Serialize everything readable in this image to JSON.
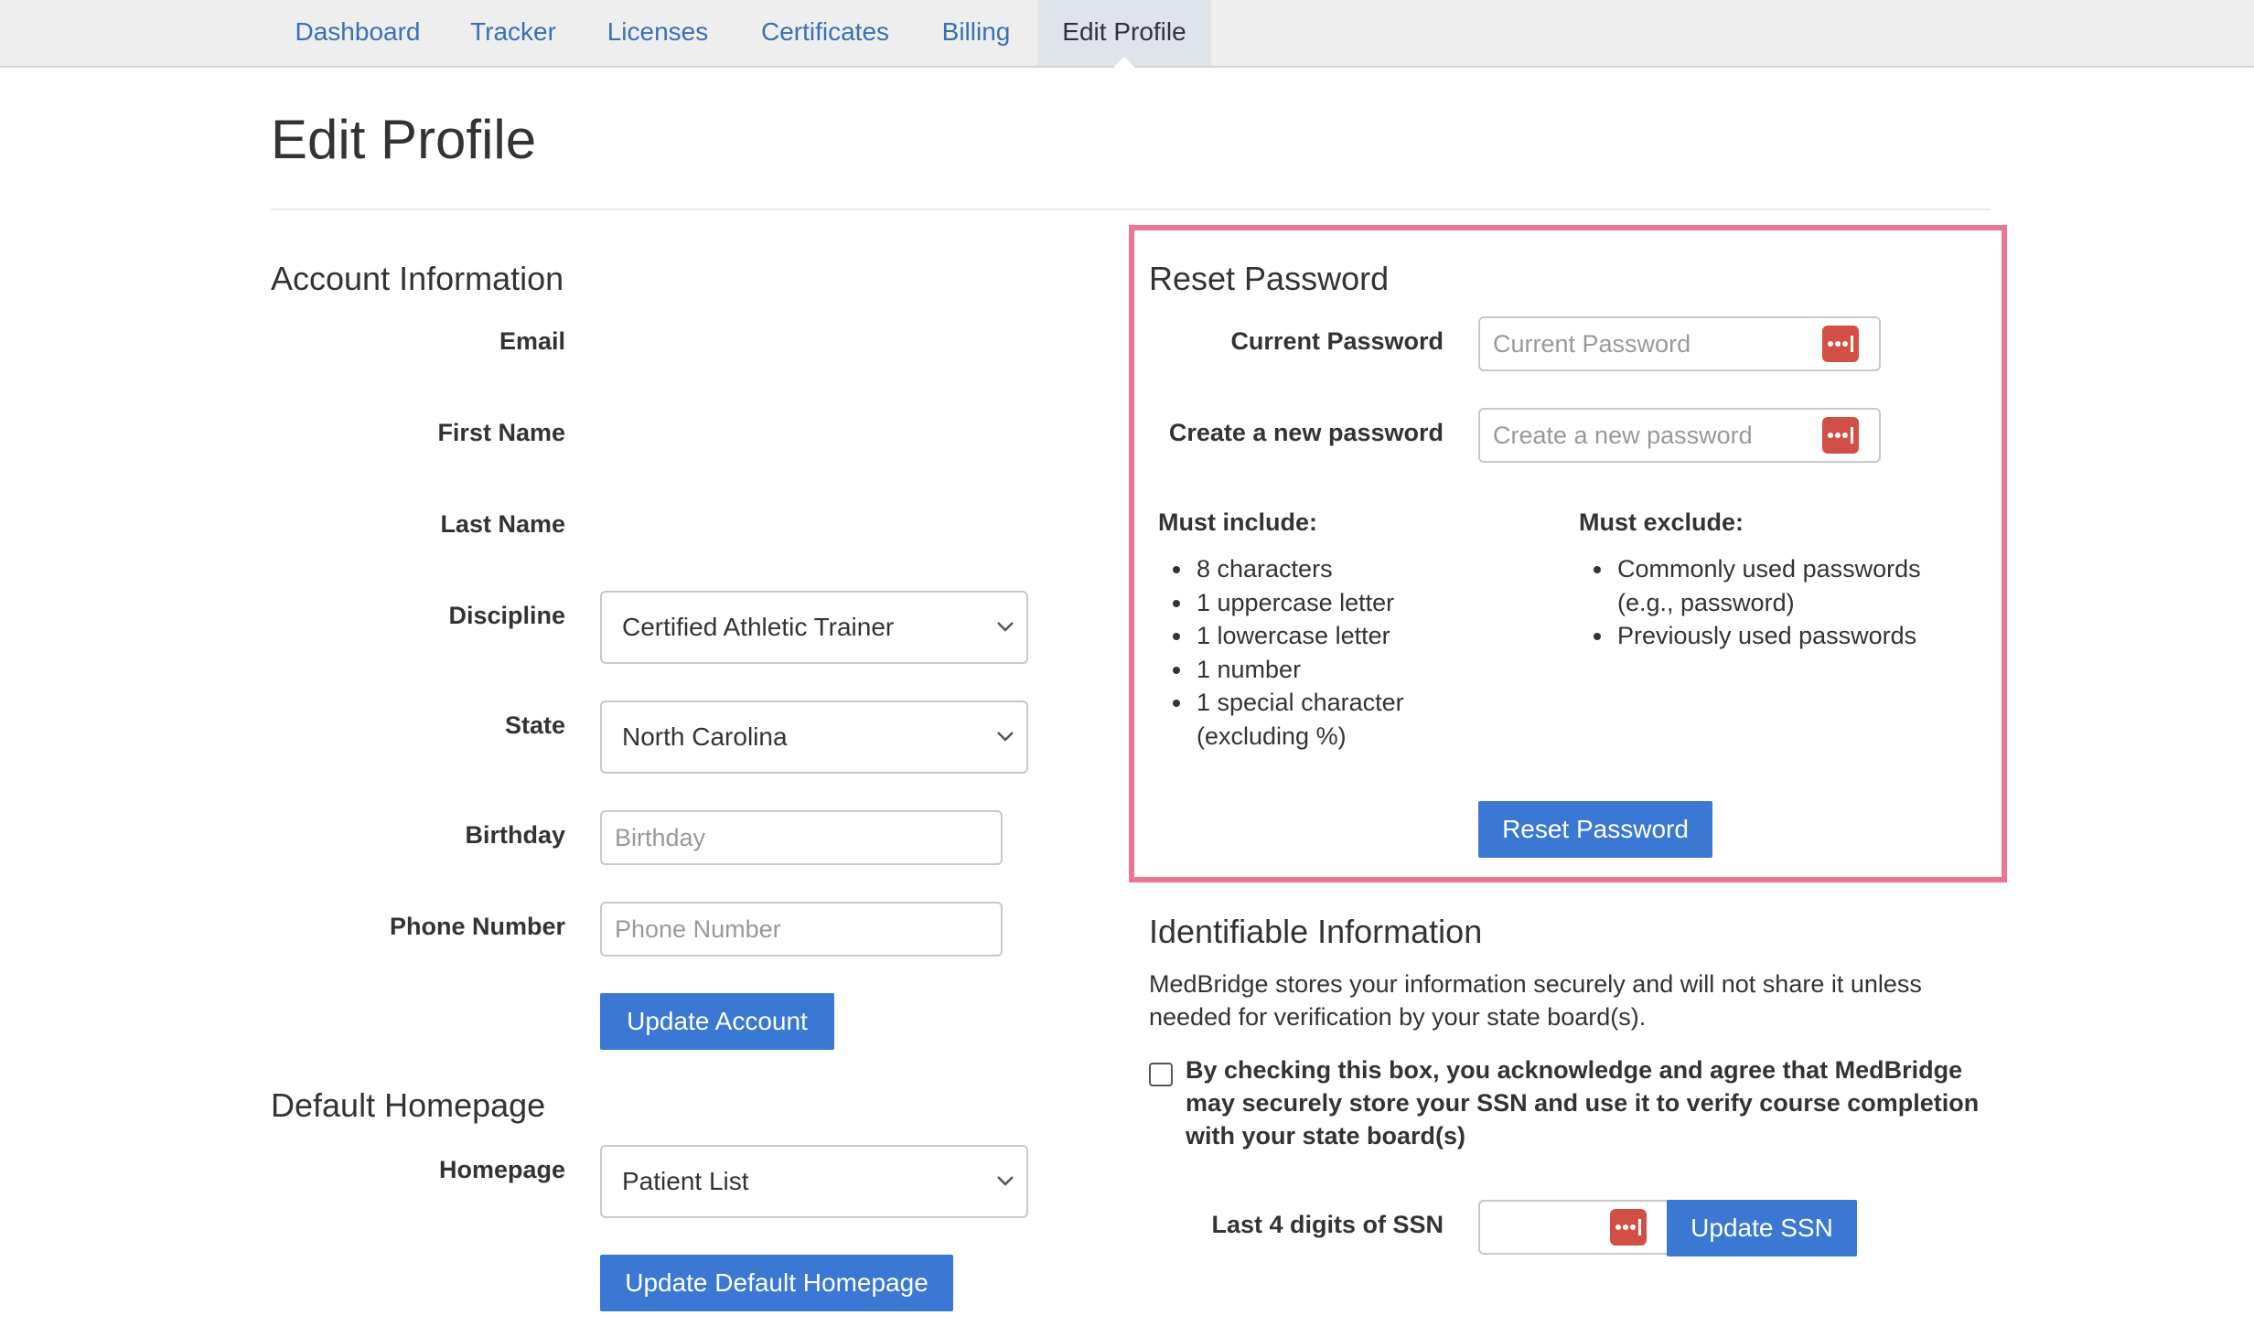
{
  "nav": {
    "tabs": [
      "Dashboard",
      "Tracker",
      "Licenses",
      "Certificates",
      "Billing",
      "Edit Profile"
    ],
    "active_tab": "Edit Profile"
  },
  "page": {
    "title": "Edit Profile"
  },
  "account": {
    "heading": "Account Information",
    "email_label": "Email",
    "first_name_label": "First Name",
    "last_name_label": "Last Name",
    "discipline_label": "Discipline",
    "discipline_value": "Certified Athletic Trainer",
    "state_label": "State",
    "state_value": "North Carolina",
    "birthday_label": "Birthday",
    "birthday_placeholder": "Birthday",
    "phone_label": "Phone Number",
    "phone_placeholder": "Phone Number",
    "update_button": "Update Account"
  },
  "homepage": {
    "heading": "Default Homepage",
    "label": "Homepage",
    "value": "Patient List",
    "update_button": "Update Default Homepage"
  },
  "reset_password": {
    "heading": "Reset Password",
    "current_label": "Current Password",
    "current_placeholder": "Current Password",
    "new_label": "Create a new password",
    "new_placeholder": "Create a new password",
    "must_include_heading": "Must include:",
    "must_include": [
      "8 characters",
      "1 uppercase letter",
      "1 lowercase letter",
      "1 number",
      "1 special character (excluding %)"
    ],
    "must_exclude_heading": "Must exclude:",
    "must_exclude": [
      "Commonly used passwords (e.g., password)",
      "Previously used passwords"
    ],
    "button": "Reset Password",
    "highlight_color": "#ec7592"
  },
  "identifiable": {
    "heading": "Identifiable Information",
    "description": "MedBridge stores your information securely and will not share it unless needed for verification by your state board(s).",
    "consent_text": "By checking this box, you acknowledge and agree that MedBridge may securely store your SSN and use it to verify course completion with your state board(s)",
    "ssn_label": "Last 4 digits of SSN",
    "ssn_button": "Update SSN"
  },
  "colors": {
    "primary_button": "#3a78d4",
    "link": "#3a6fb6",
    "password_icon": "#d24f45"
  },
  "icons": {
    "password_manager": "password-dots-icon",
    "select_caret": "chevron-down-icon"
  }
}
